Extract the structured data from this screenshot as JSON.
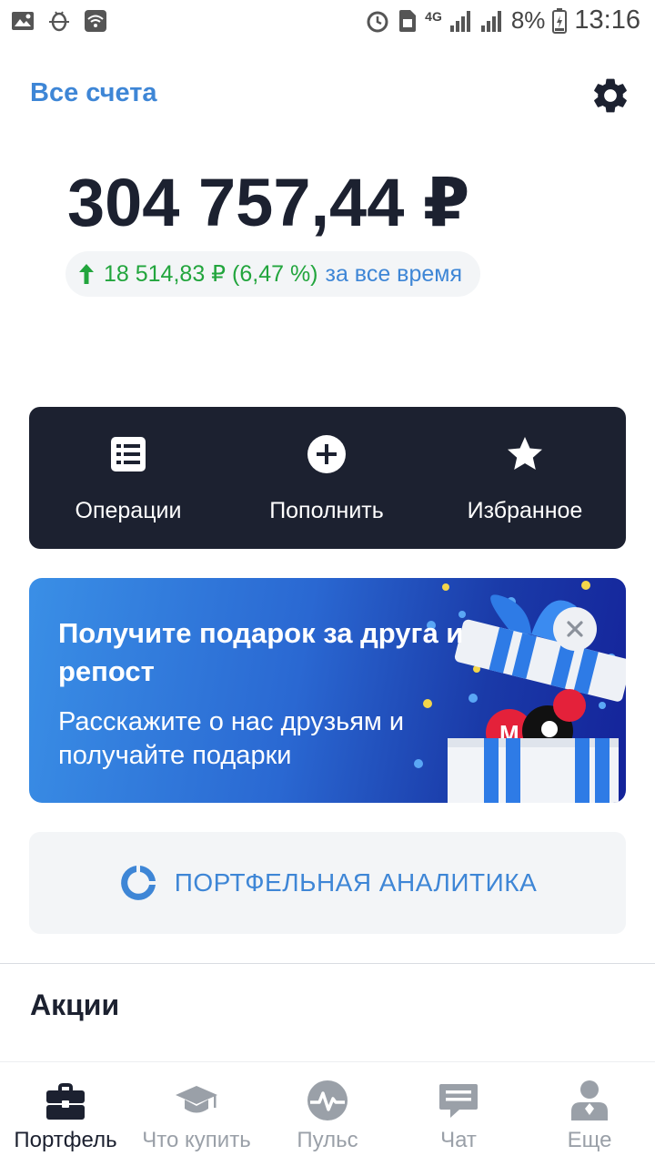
{
  "status_bar": {
    "battery": "8%",
    "time": "13:16",
    "network": "4G"
  },
  "header": {
    "accounts_link": "Все счета"
  },
  "portfolio": {
    "balance": "304 757,44 ₽",
    "change_value": "18 514,83 ₽ (6,47 %)",
    "change_period": "за все время",
    "change_color": "#22a53d"
  },
  "actions": [
    {
      "label": "Операции",
      "icon": "list-icon"
    },
    {
      "label": "Пополнить",
      "icon": "plus-circle-icon"
    },
    {
      "label": "Избранное",
      "icon": "star-icon"
    }
  ],
  "promo": {
    "title": "Получите подарок за друга и репост",
    "text": "Расскажите о нас друзьям и получайте подарки"
  },
  "analytics": {
    "label": "ПОРТФЕЛЬНАЯ АНАЛИТИКА"
  },
  "section": {
    "title": "Акции"
  },
  "bottom_nav": [
    {
      "label": "Портфель",
      "icon": "briefcase-icon",
      "active": true
    },
    {
      "label": "Что купить",
      "icon": "graduation-cap-icon",
      "active": false
    },
    {
      "label": "Пульс",
      "icon": "pulse-icon",
      "active": false
    },
    {
      "label": "Чат",
      "icon": "chat-icon",
      "active": false
    },
    {
      "label": "Еще",
      "icon": "user-icon",
      "active": false
    }
  ],
  "colors": {
    "accent": "#3e86d6",
    "dark_panel": "#1c2130",
    "positive": "#22a53d"
  }
}
